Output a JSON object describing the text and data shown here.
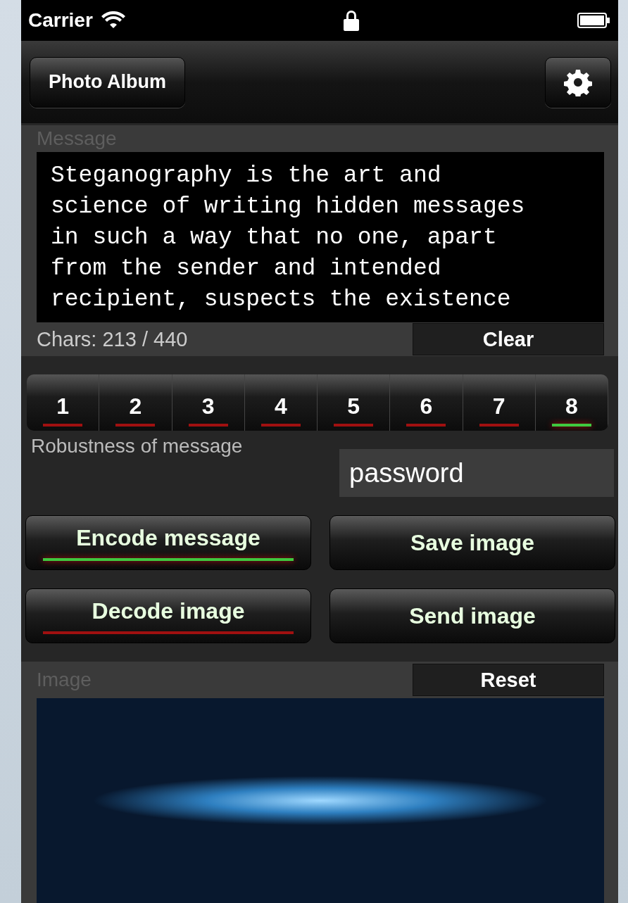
{
  "status_bar": {
    "carrier": "Carrier"
  },
  "nav_bar": {
    "left_button": "Photo Album"
  },
  "message_panel": {
    "label": "Message",
    "text": "Steganography is the art and\nscience of writing hidden messages\nin such a way that no one, apart\nfrom the sender and intended\nrecipient, suspects the existence",
    "chars": "Chars: 213 / 440",
    "clear_button": "Clear"
  },
  "robustness": {
    "segments": [
      {
        "label": "1",
        "selected": false
      },
      {
        "label": "2",
        "selected": false
      },
      {
        "label": "3",
        "selected": false
      },
      {
        "label": "4",
        "selected": false
      },
      {
        "label": "5",
        "selected": false
      },
      {
        "label": "6",
        "selected": false
      },
      {
        "label": "7",
        "selected": false
      },
      {
        "label": "8",
        "selected": true
      }
    ],
    "label": "Robustness of message"
  },
  "password_field": {
    "value": "password"
  },
  "buttons": [
    {
      "label": "Encode message",
      "kind": "mode",
      "active": true
    },
    {
      "label": "Save image",
      "kind": "action"
    },
    {
      "label": "Decode image",
      "kind": "mode",
      "active": false
    },
    {
      "label": "Send image",
      "kind": "action"
    }
  ],
  "image_panel": {
    "label": "Image",
    "reset_button": "Reset"
  }
}
